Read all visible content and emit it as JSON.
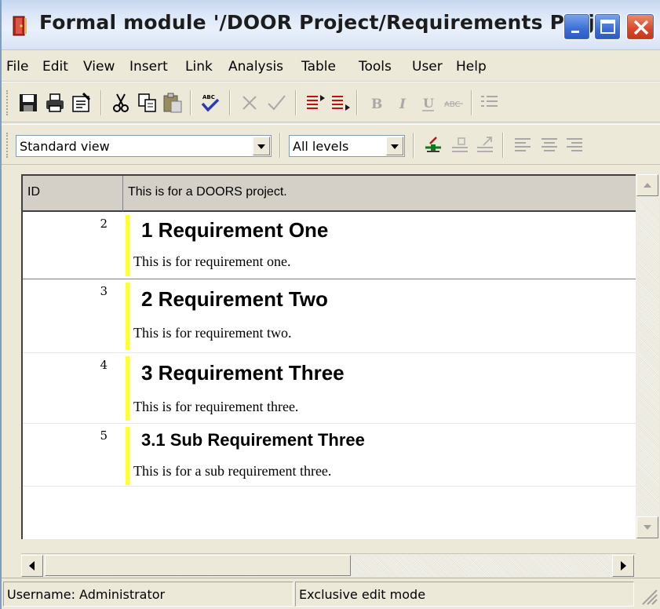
{
  "window": {
    "title": "Formal module '/DOOR Project/Requirements Proj..."
  },
  "menu": {
    "items": [
      "File",
      "Edit",
      "View",
      "Insert",
      "Link",
      "Analysis",
      "Table",
      "Tools",
      "User",
      "Help"
    ]
  },
  "toolbar1": {
    "icons": [
      "save-icon",
      "print-icon",
      "properties-icon",
      "cut-icon",
      "copy-icon",
      "paste-icon",
      "spellcheck-icon",
      "delete-icon",
      "check-icon",
      "insert-above-icon",
      "insert-below-icon",
      "bold-icon",
      "italic-icon",
      "underline-icon",
      "strikethrough-icon",
      "bullet-list-icon"
    ]
  },
  "toolbar2": {
    "view_select": "Standard view",
    "level_select": "All levels",
    "icons": [
      "link-icon",
      "link-in-icon",
      "link-out-icon",
      "align-left-icon",
      "align-center-icon",
      "align-right-icon"
    ]
  },
  "grid": {
    "col_id_header": "ID",
    "col_main_header": "This is for a DOORS project.",
    "rows": [
      {
        "id": "2",
        "heading": "1 Requirement One",
        "text": "This is for requirement one."
      },
      {
        "id": "3",
        "heading": "2 Requirement Two",
        "text": "This is for requirement two."
      },
      {
        "id": "4",
        "heading": "3 Requirement Three",
        "text": "This is for requirement three."
      },
      {
        "id": "5",
        "heading": "3.1 Sub Requirement Three",
        "text": "This is for a sub requirement three."
      }
    ]
  },
  "status": {
    "username": "Username: Administrator",
    "mode": "Exclusive edit mode"
  },
  "colors": {
    "titlebar": "#dce7f7",
    "chrome": "#ece9d8",
    "requirement_bar": "#ffff33",
    "close_button": "#d9472b",
    "caption_button": "#3b6ed6"
  }
}
